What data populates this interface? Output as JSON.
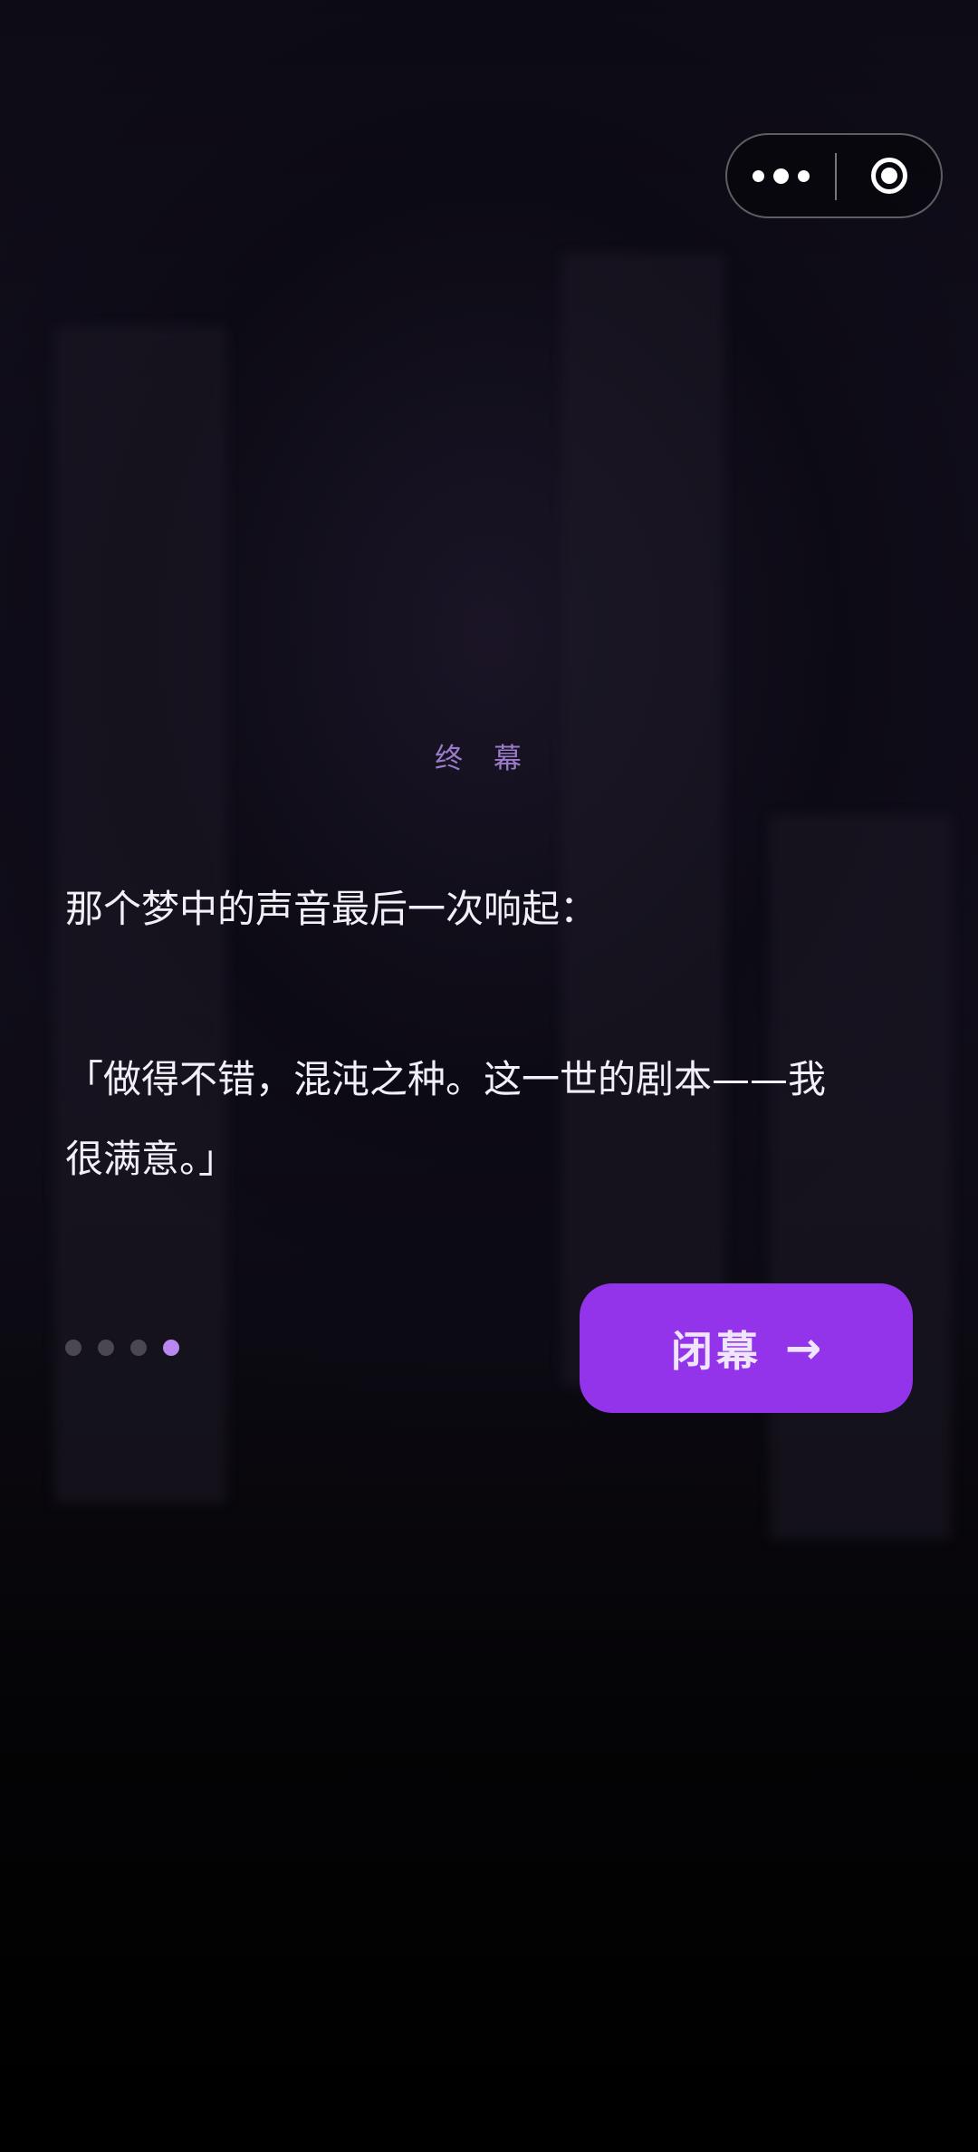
{
  "topbar": {
    "more_icon": "more-dots-icon",
    "close_icon": "target-circle-icon"
  },
  "story": {
    "chapter": "终 幕",
    "line1": "那个梦中的声音最后一次响起：",
    "quote_line1": "「做得不错，混沌之种。这一世的剧本——我",
    "quote_line2": "很满意。」"
  },
  "progress": {
    "total": 4,
    "current": 4,
    "inactive_color": "#4a4752",
    "active_color": "#b888f0"
  },
  "action": {
    "label": "闭幕",
    "arrow": "→",
    "color": "#9333ea"
  }
}
